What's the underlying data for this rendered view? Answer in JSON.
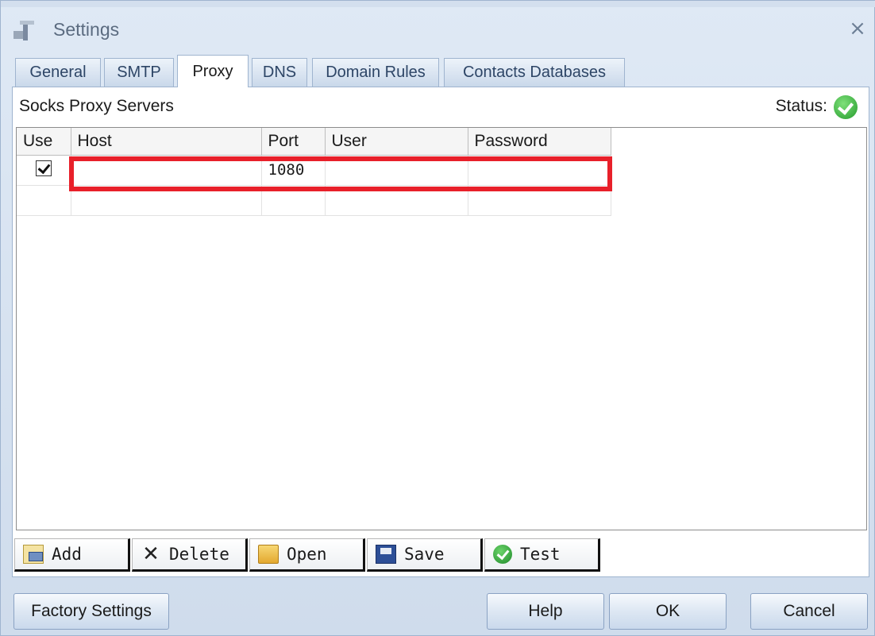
{
  "window": {
    "title": "Settings",
    "app_icon": "tools-icon",
    "close_glyph": "×"
  },
  "tabs": [
    {
      "label": "General"
    },
    {
      "label": "SMTP"
    },
    {
      "label": "Proxy",
      "active": true
    },
    {
      "label": "DNS"
    },
    {
      "label": "Domain Rules"
    },
    {
      "label": "Contacts Databases"
    }
  ],
  "panel": {
    "title": "Socks Proxy Servers",
    "status_label": "Status:",
    "status_icon": "green-check-icon"
  },
  "grid": {
    "columns": [
      "Use",
      "Host",
      "Port",
      "User",
      "Password"
    ],
    "rows": [
      {
        "use": true,
        "host": "",
        "port": "1080",
        "user": "",
        "password": ""
      },
      {
        "use": null,
        "host": "",
        "port": "",
        "user": "",
        "password": ""
      }
    ],
    "highlight_color": "#e8202a"
  },
  "toolbar": {
    "add": "Add",
    "delete": "Delete",
    "open": "Open",
    "save": "Save",
    "test": "Test"
  },
  "buttons": {
    "factory": "Factory Settings",
    "help": "Help",
    "ok": "OK",
    "cancel": "Cancel"
  }
}
